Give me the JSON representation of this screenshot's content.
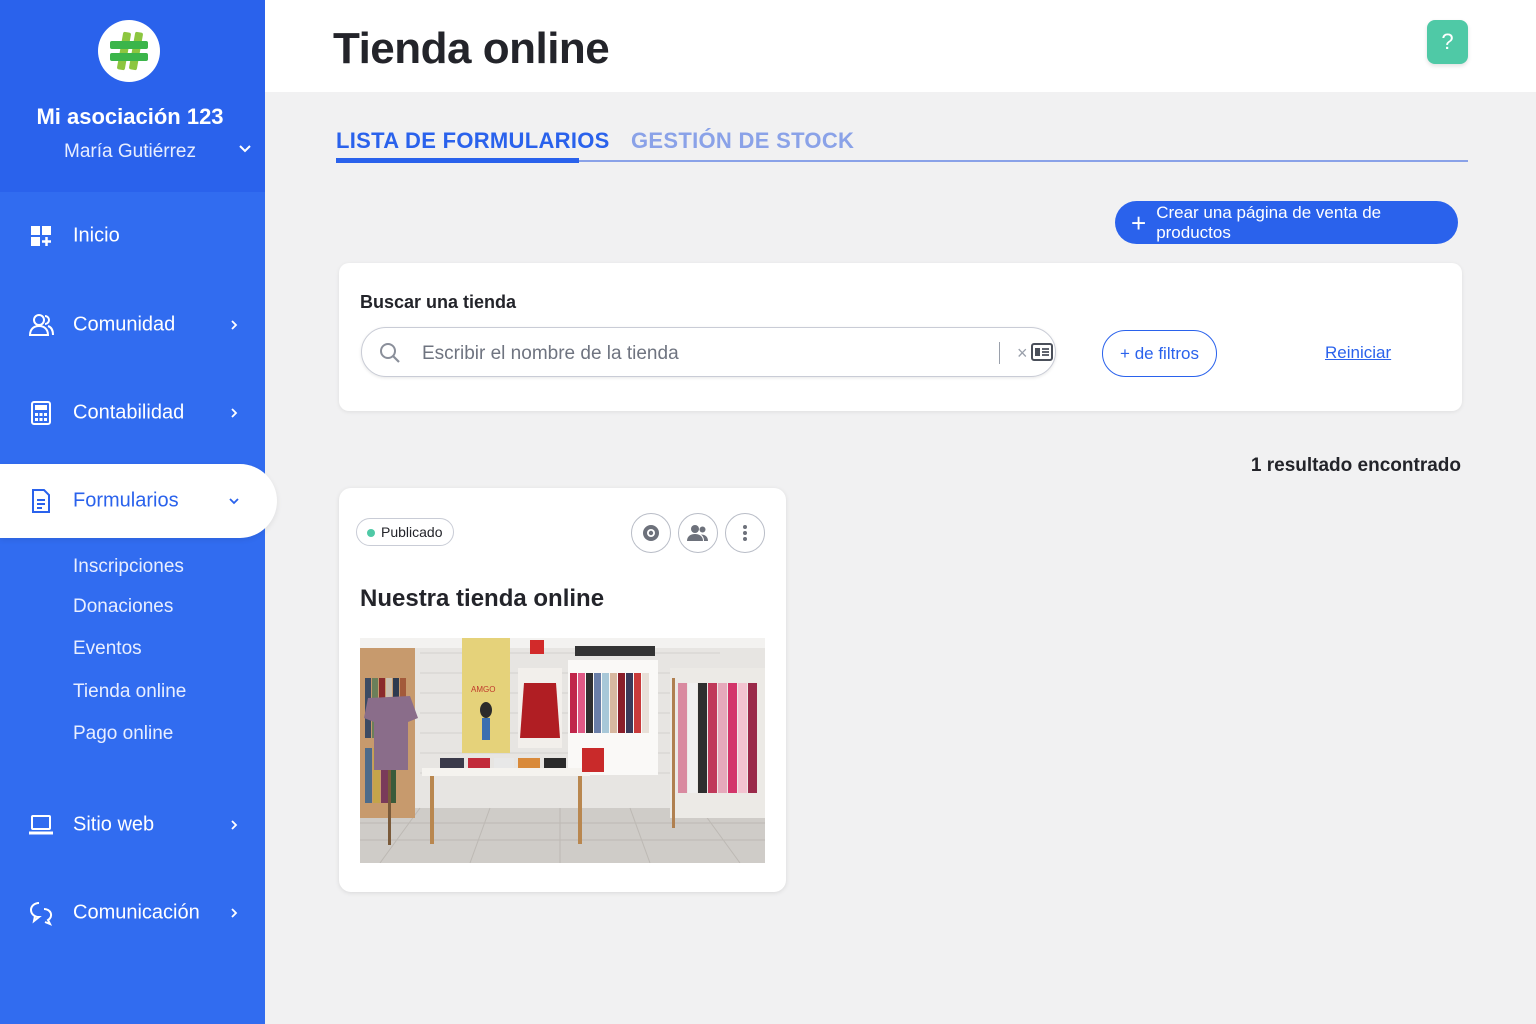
{
  "sidebar": {
    "org_name": "Mi asociación 123",
    "user_name": "María Gutiérrez",
    "nav": {
      "inicio": "Inicio",
      "comunidad": "Comunidad",
      "contabilidad": "Contabilidad",
      "formularios": "Formularios",
      "sitio_web": "Sitio web",
      "comunicacion": "Comunicación"
    },
    "subitems": [
      "Inscripciones",
      "Donaciones",
      "Eventos",
      "Tienda online",
      "Pago online"
    ]
  },
  "header": {
    "title": "Tienda online",
    "help_label": "?"
  },
  "tabs": [
    {
      "label": "LISTA DE FORMULARIOS",
      "active": true
    },
    {
      "label": "GESTIÓN DE STOCK",
      "active": false
    }
  ],
  "create_button": {
    "icon": "+",
    "label": "Crear una página de venta de productos"
  },
  "search": {
    "label": "Buscar una tienda",
    "placeholder": "Escribir el nombre de la tienda",
    "value": "",
    "clear_glyph": "×",
    "filters_label": "+ de filtros",
    "reset_label": "Reiniciar"
  },
  "results_text": "1 resultado encontrado",
  "store_card": {
    "status": "Publicado",
    "title": "Nuestra tienda online",
    "image_sign": "AMGO"
  },
  "colors": {
    "primary": "#2a62ec",
    "sidebar": "#316cf0",
    "accent_green": "#4fc9a6",
    "text_dark": "#23242a",
    "background": "#f1f1f2"
  },
  "icons": {
    "logo": "hash-logo-icon",
    "inicio": "dashboard-icon",
    "comunidad": "users-icon",
    "contabilidad": "calculator-icon",
    "formularios": "document-icon",
    "sitio_web": "laptop-icon",
    "comunicacion": "chat-icon",
    "search": "search-icon",
    "id_card": "id-card-icon",
    "view": "eye-icon",
    "participants": "people-icon",
    "more": "more-vertical-icon"
  }
}
